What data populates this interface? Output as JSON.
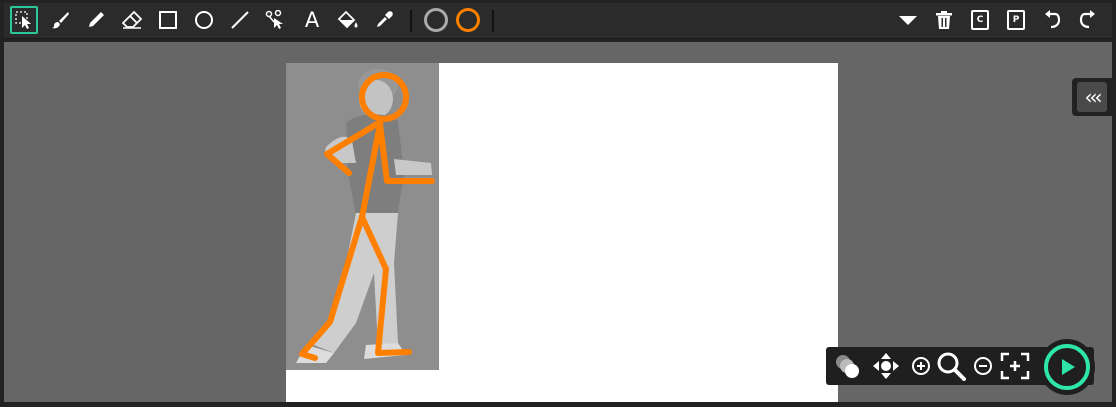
{
  "colors": {
    "accent": "#2cc79a",
    "play_ring": "#2ee6a8",
    "stroke_color": "#ff7f00",
    "secondary_color": "#aaaaaa",
    "workspace": "#666666",
    "canvas": "#ffffff",
    "toolbar": "#2b2b2b"
  },
  "toolbar": {
    "left_tools": [
      {
        "name": "select-tool",
        "icon": "select-icon",
        "active": true
      },
      {
        "name": "brush-tool",
        "icon": "brush-icon"
      },
      {
        "name": "pencil-tool",
        "icon": "pencil-icon"
      },
      {
        "name": "eraser-tool",
        "icon": "eraser-icon"
      },
      {
        "name": "rectangle-tool",
        "icon": "rectangle-icon"
      },
      {
        "name": "ellipse-tool",
        "icon": "ellipse-icon"
      },
      {
        "name": "line-tool",
        "icon": "line-icon"
      },
      {
        "name": "path-tool",
        "icon": "bezier-path-icon"
      },
      {
        "name": "text-tool",
        "icon": "text-icon"
      },
      {
        "name": "fill-tool",
        "icon": "paint-bucket-icon"
      },
      {
        "name": "eyedropper-tool",
        "icon": "eyedropper-icon"
      }
    ],
    "text_tool_glyph": "A",
    "color_swatches": [
      {
        "name": "fill-color-swatch",
        "color": "#aaaaaa"
      },
      {
        "name": "stroke-color-swatch",
        "color": "#ff7f00"
      }
    ],
    "right_tools": [
      {
        "name": "more-dropdown-button",
        "icon": "caret-down-icon"
      },
      {
        "name": "delete-button",
        "icon": "trash-icon"
      },
      {
        "name": "copy-button",
        "icon": "copy-c-icon",
        "glyph": "C"
      },
      {
        "name": "paste-button",
        "icon": "paste-p-icon",
        "glyph": "P"
      },
      {
        "name": "undo-button",
        "icon": "undo-icon"
      },
      {
        "name": "redo-button",
        "icon": "redo-icon"
      }
    ]
  },
  "sidebar_toggle": {
    "icon": "triple-chevron-left-icon",
    "glyph": "‹‹‹"
  },
  "bottom_tools": [
    {
      "name": "onion-skin-button",
      "icon": "onion-skin-icon"
    },
    {
      "name": "pan-button",
      "icon": "move-arrows-icon"
    },
    {
      "name": "zoom-in-button",
      "icon": "zoom-in-icon"
    },
    {
      "name": "zoom-button",
      "icon": "magnifier-icon"
    },
    {
      "name": "zoom-out-button",
      "icon": "zoom-out-icon"
    },
    {
      "name": "fit-screen-button",
      "icon": "fit-screen-icon"
    }
  ],
  "play_button": {
    "icon": "play-icon"
  }
}
